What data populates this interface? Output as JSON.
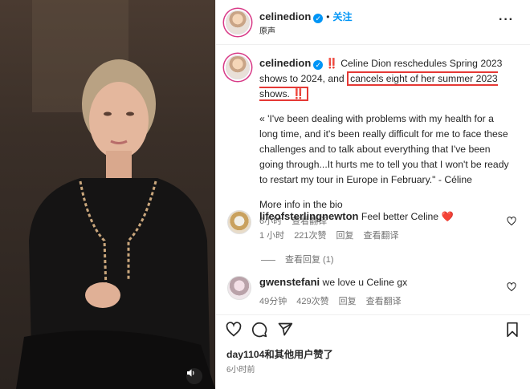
{
  "post": {
    "username": "celinedion",
    "follow_label": "关注",
    "audio_label": "原声"
  },
  "caption": {
    "username": "celinedion",
    "text_before": " ‼️ Celine Dion reschedules Spring 2023 shows to 2024, and ",
    "highlighted_text": "cancels eight of her summer 2023 shows. ‼️",
    "quote": "« 'I've been dealing with problems with my health for a long time, and it's been really difficult for me to face these challenges and to talk about everything that I've been going through...It hurts me to tell you that I won't be ready to restart my tour in Europe in February.\" - Céline",
    "more_info": "More info in the bio",
    "time": "6小时",
    "translate": "查看翻译"
  },
  "comments": [
    {
      "username": "lifeofsterlingnewton",
      "text": "Feel better Celine",
      "emoji": "❤️",
      "time": "1 小时",
      "likes": "221次赞",
      "reply": "回复",
      "translate": "查看翻译"
    },
    {
      "username": "gwenstefani",
      "text": "we love u Celine gx",
      "time": "49分钟",
      "likes": "429次赞",
      "reply": "回复",
      "translate": "查看翻译"
    }
  ],
  "view_replies": "查看回复 (1)",
  "likes_summary": "day1104和其他用户赞了",
  "posted_time": "6小时前",
  "colors": {
    "accent": "#0095f6",
    "highlight_box": "#e53935",
    "heart": "#ed4956"
  }
}
